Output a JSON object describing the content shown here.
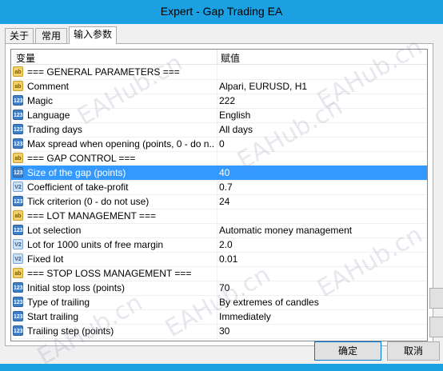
{
  "window": {
    "title": "Expert - Gap Trading EA"
  },
  "tabs": [
    {
      "label": "关于"
    },
    {
      "label": "常用"
    },
    {
      "label": "输入参数"
    }
  ],
  "table": {
    "headers": {
      "variable": "变量",
      "value": "赋值"
    },
    "rows": [
      {
        "icon": "ab",
        "name": "=== GENERAL PARAMETERS ===",
        "value": ""
      },
      {
        "icon": "ab",
        "name": "Comment",
        "value": "Alpari, EURUSD, H1"
      },
      {
        "icon": "n",
        "name": "Magic",
        "value": "222"
      },
      {
        "icon": "n",
        "name": "Language",
        "value": "English"
      },
      {
        "icon": "n",
        "name": "Trading days",
        "value": "All days"
      },
      {
        "icon": "n",
        "name": "Max spread when opening (points, 0 - do n...",
        "value": "0"
      },
      {
        "icon": "ab",
        "name": "=== GAP CONTROL ===",
        "value": ""
      },
      {
        "icon": "n",
        "name": "Size of the gap (points)",
        "value": "40"
      },
      {
        "icon": "f",
        "name": "Coefficient of take-profit",
        "value": "0.7"
      },
      {
        "icon": "n",
        "name": "Tick criterion (0 - do not use)",
        "value": "24"
      },
      {
        "icon": "ab",
        "name": "=== LOT MANAGEMENT ===",
        "value": ""
      },
      {
        "icon": "n",
        "name": "Lot selection",
        "value": "Automatic money management"
      },
      {
        "icon": "f",
        "name": "Lot for 1000 units of free margin",
        "value": "2.0"
      },
      {
        "icon": "f",
        "name": "Fixed lot",
        "value": "0.01"
      },
      {
        "icon": "ab",
        "name": "=== STOP LOSS MANAGEMENT ===",
        "value": ""
      },
      {
        "icon": "n",
        "name": "Initial stop loss (points)",
        "value": "70"
      },
      {
        "icon": "n",
        "name": "Type of trailing",
        "value": "By extremes of candles"
      },
      {
        "icon": "n",
        "name": "Start trailing",
        "value": "Immediately"
      },
      {
        "icon": "n",
        "name": "Trailing step (points)",
        "value": "30"
      }
    ],
    "selected_row": 7
  },
  "icon_labels": {
    "ab": "ab",
    "n": "123",
    "f": "V2"
  },
  "buttons": {
    "ok": "确定",
    "cancel": "取消"
  },
  "watermark": "EAHub.cn"
}
